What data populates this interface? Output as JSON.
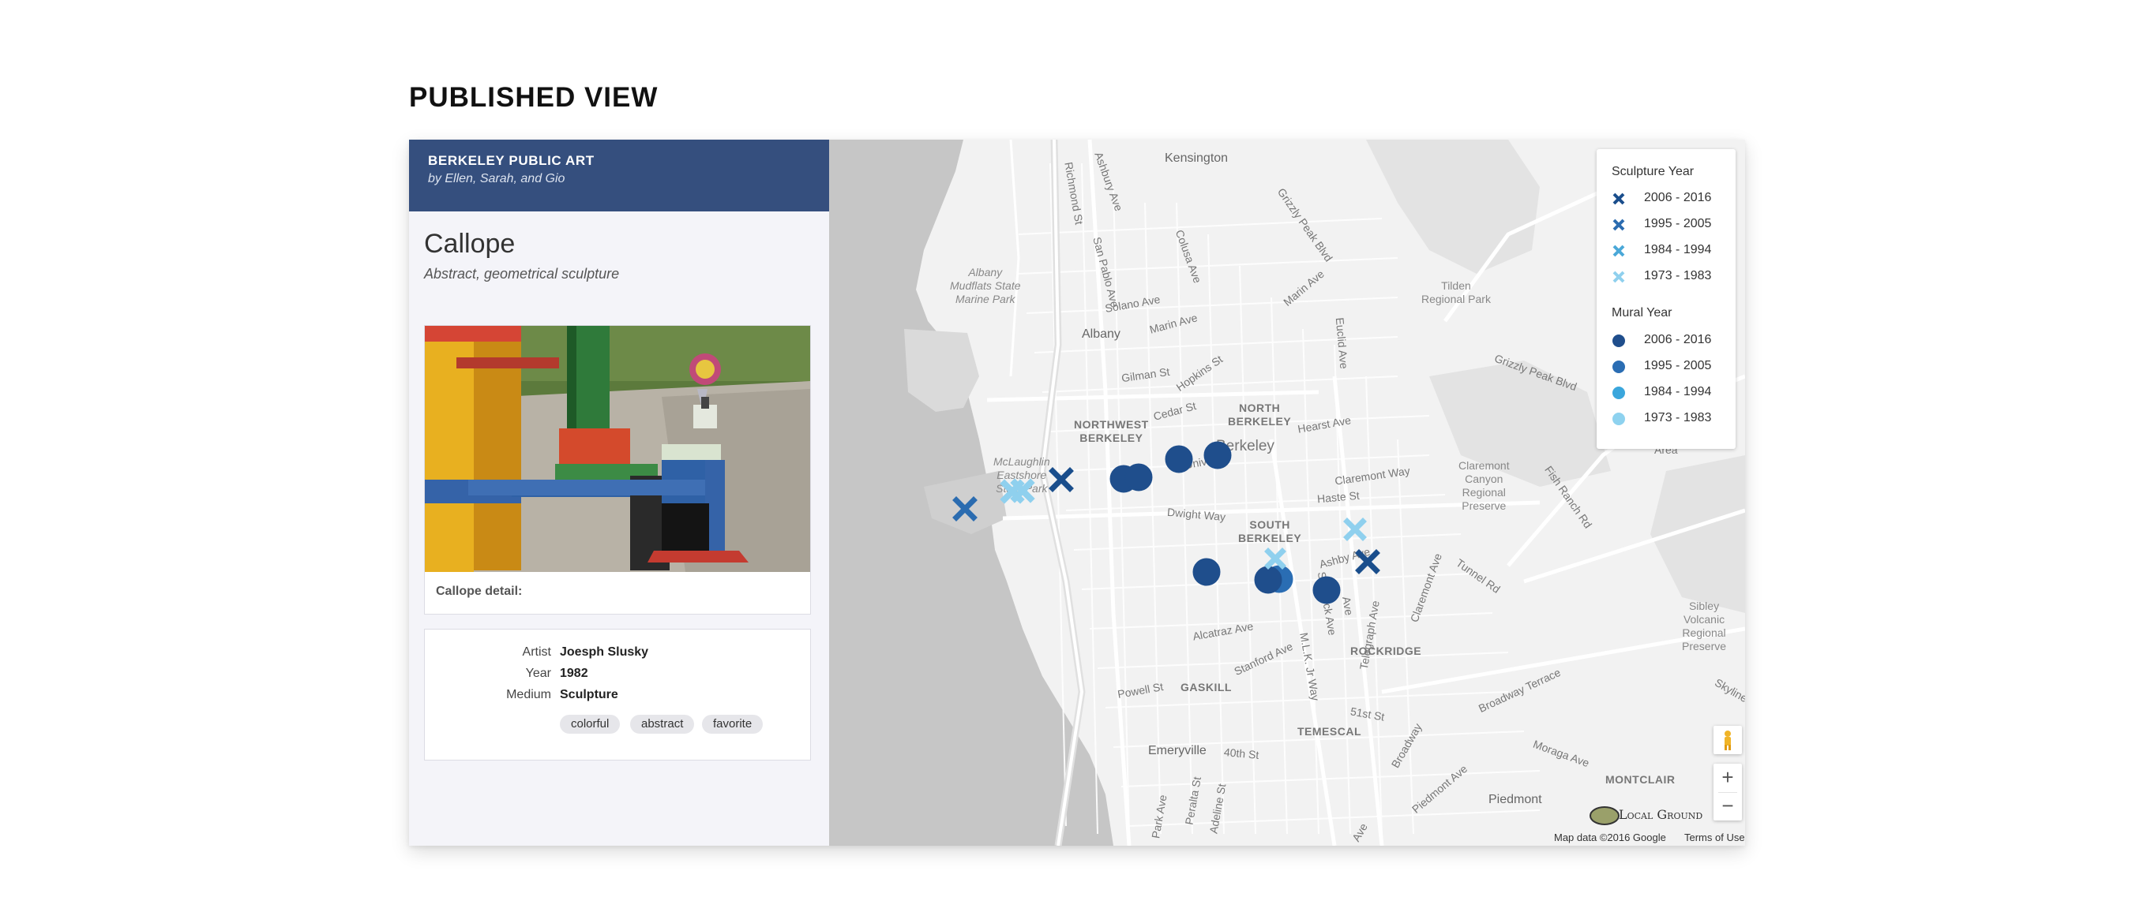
{
  "page": {
    "heading": "PUBLISHED VIEW"
  },
  "project": {
    "title": "BERKELEY PUBLIC ART",
    "byline": "by Ellen, Sarah, and Gio"
  },
  "record": {
    "title": "Callope",
    "subtitle": "Abstract, geometrical sculpture",
    "photo_caption": "Callope detail:",
    "fields": [
      {
        "label": "Artist",
        "value": "Joesph Slusky"
      },
      {
        "label": "Year",
        "value": "1982"
      },
      {
        "label": "Medium",
        "value": "Sculpture"
      }
    ],
    "tags": [
      "colorful",
      "abstract",
      "favorite"
    ]
  },
  "map": {
    "place_labels": {
      "kensington": "Kensington",
      "albany": "Albany",
      "albany_marine": "Albany\nMudflats State\nMarine Park",
      "tilden": "Tilden\nRegional Park",
      "northwest_berkeley": "NORTHWEST\nBERKELEY",
      "north_berkeley": "NORTH\nBERKELEY",
      "berkeley": "Berkeley",
      "mclaughlin": "McLaughlin\nEastshore\nState Park",
      "claremont": "Claremont\nCanyon\nRegional\nPreserve",
      "south_berkeley": "SOUTH\nBERKELEY",
      "rockridge": "ROCKRIDGE",
      "gaskill": "GASKILL",
      "temescal": "TEMESCAL",
      "emeryville": "Emeryville",
      "piedmont": "Piedmont",
      "montclair": "MONTCLAIR",
      "sibley": "Sibley\nVolcanic\nRegional\nPreserve",
      "area": "Area"
    },
    "street_labels": {
      "ashbury": "Ashbury Ave",
      "richmond": "Richmond St",
      "san_pablo": "San Pablo Ave",
      "colusa": "Colusa Ave",
      "grizzly": "Grizzly Peak Blvd",
      "marin": "Marin Ave",
      "solano": "Solano Ave",
      "euclid": "Euclid Ave",
      "gilman": "Gilman St",
      "hopkins": "Hopkins St",
      "cedar": "Cedar St",
      "hearst": "Hearst Ave",
      "grizzly2": "Grizzly Peak Blvd",
      "claremont_way": "Claremont Way",
      "haste": "Haste St",
      "dwight": "Dwight Way",
      "ashby": "Ashby Ave",
      "tunnel": "Tunnel Rd",
      "fish_ranch": "Fish Ranch Rd",
      "claremont_ave": "Claremont Ave",
      "alcatraz": "Alcatraz Ave",
      "stanford": "Stanford Ave",
      "mlk": "M.L.K. Jr Way",
      "telegraph": "Telegraph Ave",
      "shattuck": "Shattuck Ave",
      "powell": "Powell St",
      "broadway_terrace": "Broadway Terrace",
      "skyline": "Skyline",
      "st51": "51st St",
      "broadway": "Broadway",
      "moraga": "Moraga Ave",
      "piedmont_ave": "Piedmont Ave",
      "st40": "40th St",
      "peralta": "Peralta St",
      "adeline": "Adeline St",
      "park": "Park Ave",
      "university": "Universi",
      "n_ave": "Ave"
    },
    "legend": {
      "sculpture_heading": "Sculpture Year",
      "sculpture_items": [
        {
          "label": "2006 - 2016",
          "color": "#1a4e8c"
        },
        {
          "label": "1995 - 2005",
          "color": "#2b6cb0"
        },
        {
          "label": "1984 - 1994",
          "color": "#4aa8d8"
        },
        {
          "label": "1973 - 1983",
          "color": "#8fd0ee"
        }
      ],
      "mural_heading": "Mural Year",
      "mural_items": [
        {
          "label": "2006 - 2016",
          "color": "#1f4e8c"
        },
        {
          "label": "1995 - 2005",
          "color": "#2a6db3"
        },
        {
          "label": "1984 - 1994",
          "color": "#3aa6dc"
        },
        {
          "label": "1973 - 1983",
          "color": "#8ed2ef"
        }
      ],
      "symbols": {
        "sculpture": "x-icon",
        "mural": "circle-icon"
      }
    },
    "controls": {
      "zoom_in": "+",
      "zoom_out": "−",
      "street_view": "pegman-icon"
    },
    "brand": "Local Ground",
    "attribution": "Map data ©2016 Google",
    "terms": "Terms of Use"
  }
}
